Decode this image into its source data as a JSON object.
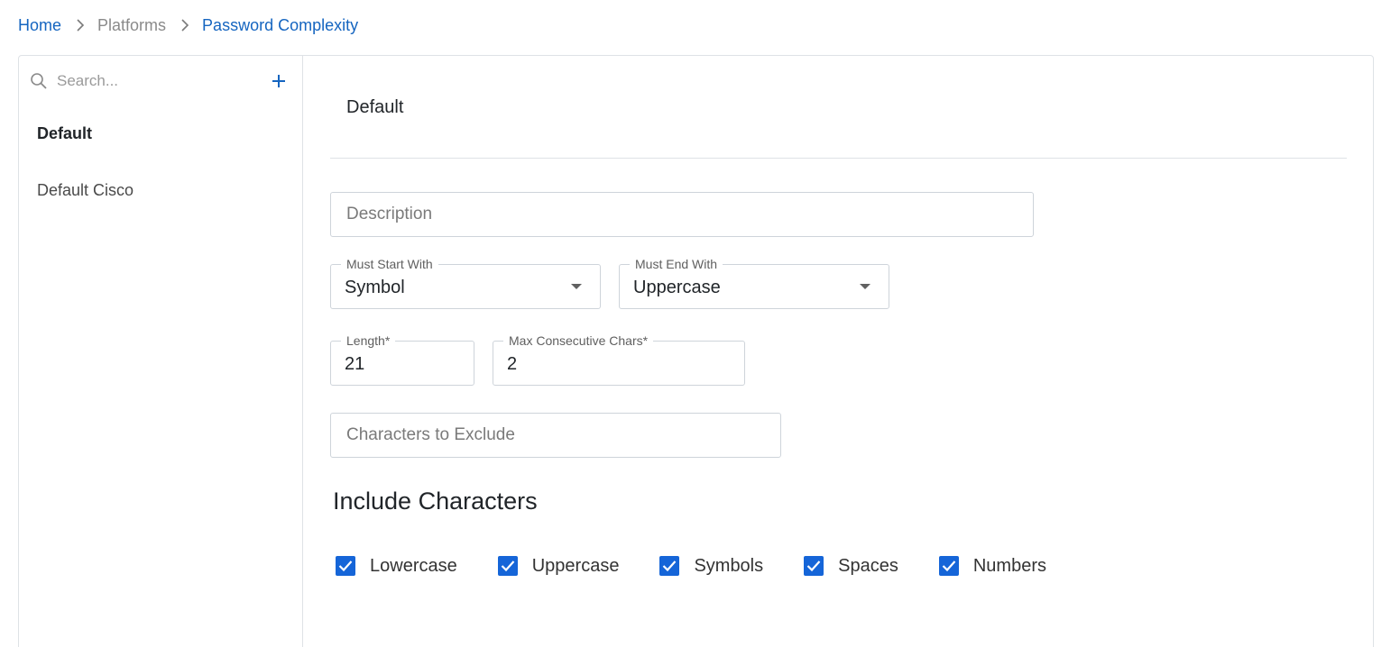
{
  "breadcrumb": {
    "home": "Home",
    "platforms": "Platforms",
    "current": "Password Complexity"
  },
  "sidebar": {
    "search_placeholder": "Search...",
    "items": [
      {
        "label": "Default",
        "active": true
      },
      {
        "label": "Default Cisco",
        "active": false
      }
    ]
  },
  "main": {
    "title": "Default",
    "description": {
      "placeholder": "Description",
      "value": ""
    },
    "must_start_with": {
      "label": "Must Start With",
      "value": "Symbol"
    },
    "must_end_with": {
      "label": "Must End With",
      "value": "Uppercase"
    },
    "length": {
      "label": "Length*",
      "value": "21"
    },
    "max_consecutive": {
      "label": "Max Consecutive Chars*",
      "value": "2"
    },
    "exclude": {
      "placeholder": "Characters to Exclude",
      "value": ""
    },
    "include_heading": "Include Characters",
    "include": [
      {
        "label": "Lowercase",
        "checked": true
      },
      {
        "label": "Uppercase",
        "checked": true
      },
      {
        "label": "Symbols",
        "checked": true
      },
      {
        "label": "Spaces",
        "checked": true
      },
      {
        "label": "Numbers",
        "checked": true
      }
    ]
  },
  "colors": {
    "accent": "#1565d8",
    "link": "#1565c0",
    "border": "#dee2e6"
  },
  "icons": [
    "chevron-right-icon",
    "search-icon",
    "plus-icon",
    "chevron-down-icon",
    "checkmark-icon"
  ]
}
